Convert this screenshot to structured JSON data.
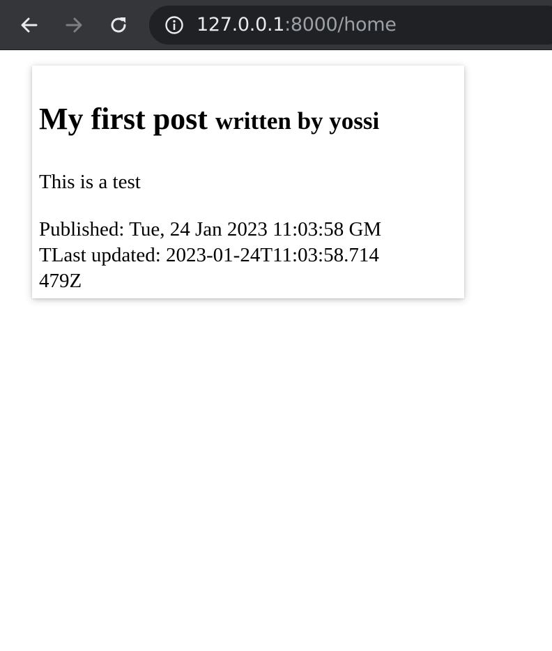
{
  "browser": {
    "url_host": "127.0.0.1",
    "url_rest": ":8000/home",
    "icons": {
      "back": "back-arrow-icon",
      "forward": "forward-arrow-icon",
      "reload": "reload-icon",
      "info": "info-icon"
    },
    "colors": {
      "toolbar": "#35363a",
      "omnibox": "#202124",
      "host_text": "#e8eaed",
      "muted_text": "#9aa0a6"
    }
  },
  "post": {
    "title": "My first post",
    "byline": "written by yossi",
    "body": "This is a test",
    "published_label": "Published: ",
    "published_value": "Tue, 24 Jan 2023 11:03:58 GMT",
    "updated_label": "Last updated: ",
    "updated_value": "2023-01-24T11:03:58.714479Z"
  }
}
